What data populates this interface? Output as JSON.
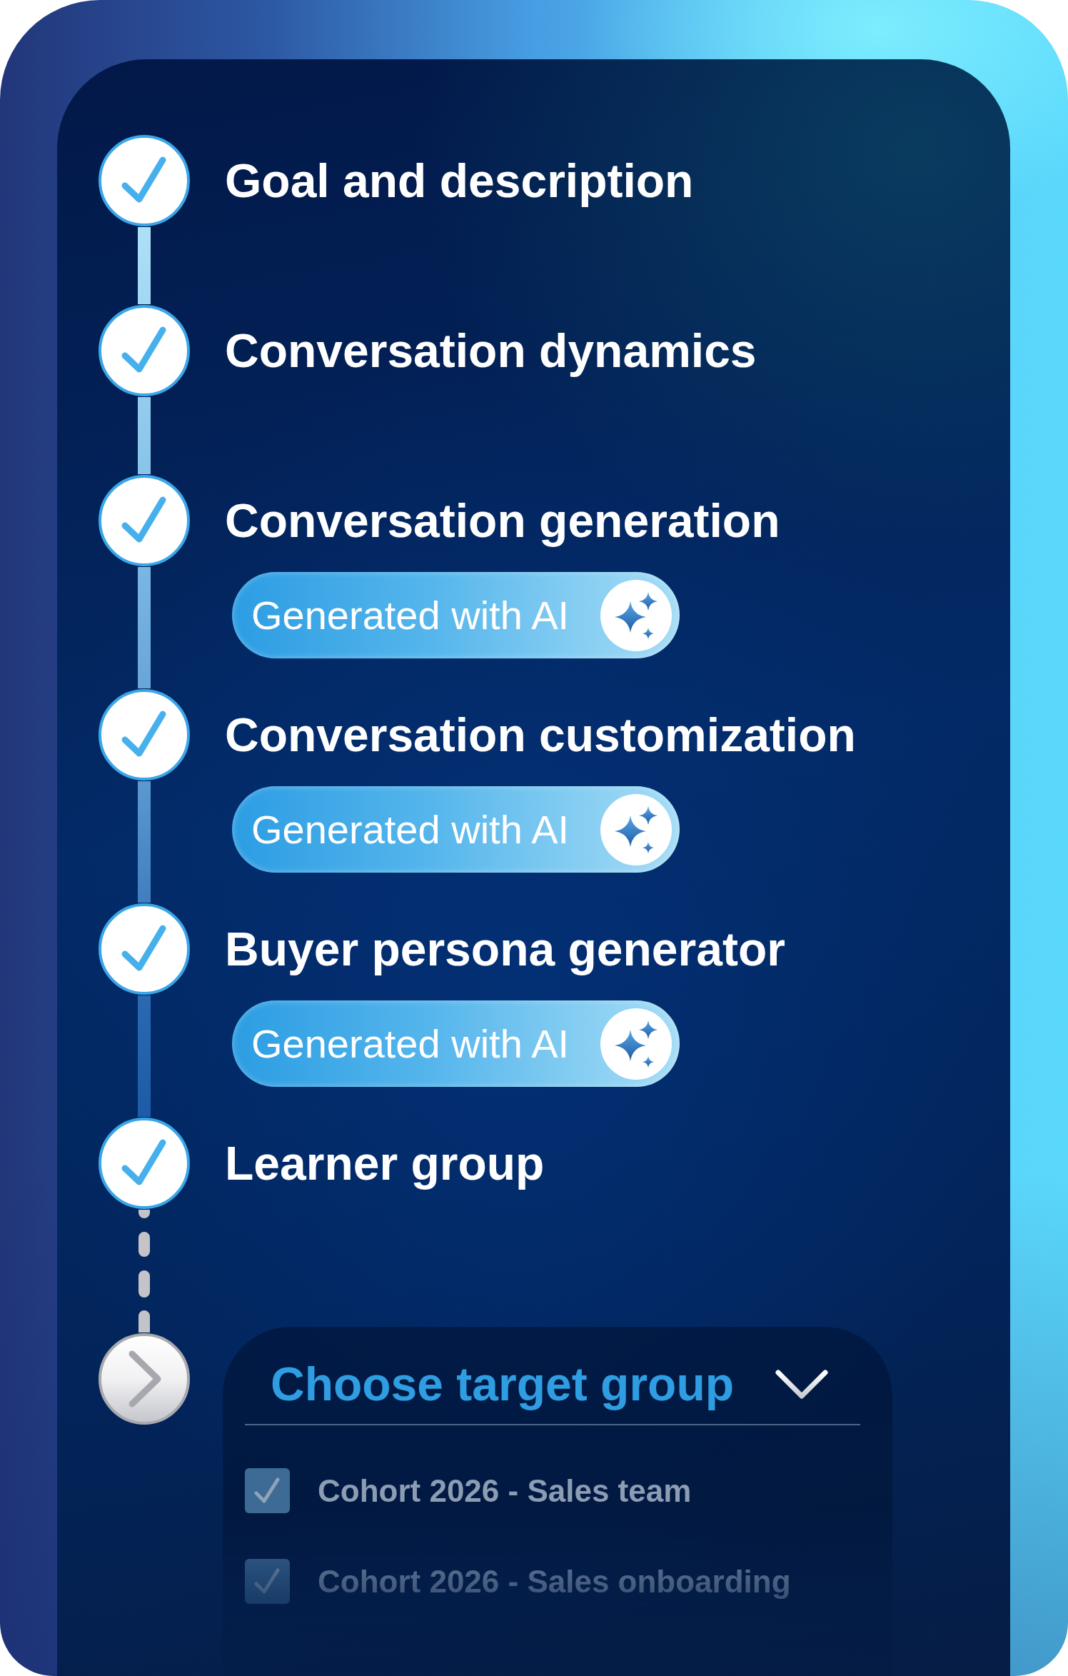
{
  "steps": [
    {
      "title": "Goal and description",
      "completed": true
    },
    {
      "title": "Conversation dynamics",
      "completed": true
    },
    {
      "title": "Conversation generation",
      "completed": true,
      "badge": "Generated with AI"
    },
    {
      "title": "Conversation customization",
      "completed": true,
      "badge": "Generated with AI"
    },
    {
      "title": "Buyer persona generator",
      "completed": true,
      "badge": "Generated with AI"
    },
    {
      "title": "Learner group",
      "completed": true
    },
    {
      "completed": false,
      "dropdown": {
        "label": "Choose target group",
        "expanded": true,
        "options": [
          {
            "label": "Cohort 2026 - Sales team",
            "checked": true
          },
          {
            "label": "Cohort 2026 - Sales onboarding",
            "checked": true
          }
        ]
      }
    }
  ]
}
